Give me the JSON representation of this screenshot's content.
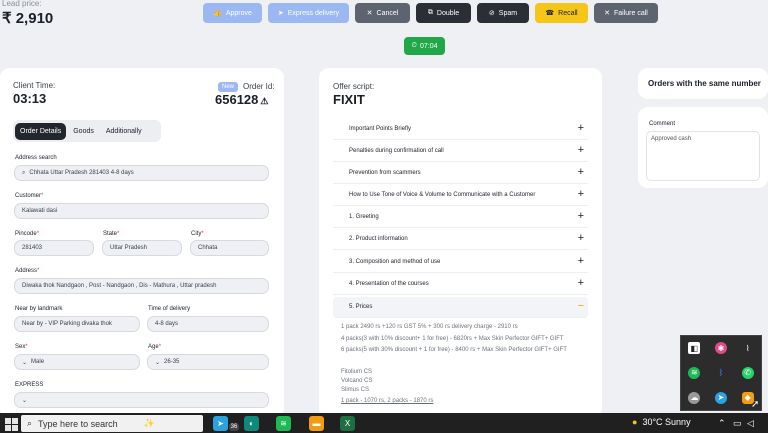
{
  "lead": {
    "label": "Lead price:",
    "price": "₹ 2,910"
  },
  "actions": [
    {
      "label": "Approve",
      "icon": "thumbs-up-icon"
    },
    {
      "label": "Express delivery",
      "icon": "send-icon"
    },
    {
      "label": "Cancel",
      "icon": "cancel-icon"
    },
    {
      "label": "Double",
      "icon": "double-icon"
    },
    {
      "label": "Spam",
      "icon": "spam-icon"
    },
    {
      "label": "Recall",
      "icon": "phone-icon"
    },
    {
      "label": "Failure call",
      "icon": "close-icon"
    }
  ],
  "timer": {
    "value": "07:04"
  },
  "order": {
    "client_time_label": "Client Time:",
    "client_time": "03:13",
    "badge": "New",
    "order_id_label": "Order Id:",
    "order_id": "656128"
  },
  "tabs": [
    "Order Details",
    "Goods",
    "Additionally"
  ],
  "form": {
    "address_search_label": "Address search",
    "address_search": "Chhata Uttar Pradesh 281403 4-8 days",
    "customer_label": "Customer",
    "customer": "Kalawati dasi",
    "pincode_label": "Pincode",
    "pincode": "281403",
    "state_label": "State",
    "state": "Uttar Pradesh",
    "city_label": "City",
    "city": "Chhata",
    "address_label": "Address",
    "address": "Diwaka thok Nandgaon , Post - Nandgaon , Dis - Mathura , Uttar pradesh",
    "landmark_label": "Near by landmark",
    "landmark": "Near by - VIP Parking divaka thok",
    "delivery_label": "Time of delivery",
    "delivery": "4-8 days",
    "sex_label": "Sex",
    "sex": "Male",
    "age_label": "Age",
    "age": "26-35",
    "express_label": "EXPRESS"
  },
  "offer": {
    "label": "Offer script:",
    "name": "FIXIT",
    "items": [
      "Important Points Briefly",
      "Penalties during confirmation of call",
      "Prevention from scammers",
      "How to Use Tone of Voice & Volume to Communicate with a Customer",
      "1. Greeting",
      "2. Product information",
      "3. Composition and method of use",
      "4. Presentation of the courses",
      "5. Prices"
    ],
    "prices": [
      "1 pack 2490 rs +120 rs GST 5% + 300 rs delivery charge - 2910 rs",
      "4 packs(3 with 10% discount+ 1 for free) - 6820rs + Max Skin Perfector GIFT+ GIFT",
      "6 packs(5 with 30% discount + 1 for free) - 8400 rs + Max Skin Perfector GIFT+ GIFT"
    ],
    "products": [
      "Fitolium CS",
      "Volcano CS",
      "Slimus CS"
    ],
    "pack_note": "1 pack - 1070 rs, 2 packs - 1870 rs"
  },
  "right": {
    "same_number_title": "Orders with the same number",
    "comment_label": "Comment",
    "comment": "Approved cash"
  },
  "taskbar": {
    "search_placeholder": "Type here to search",
    "edge_badge": "36",
    "weather": "30°C  Sunny"
  }
}
